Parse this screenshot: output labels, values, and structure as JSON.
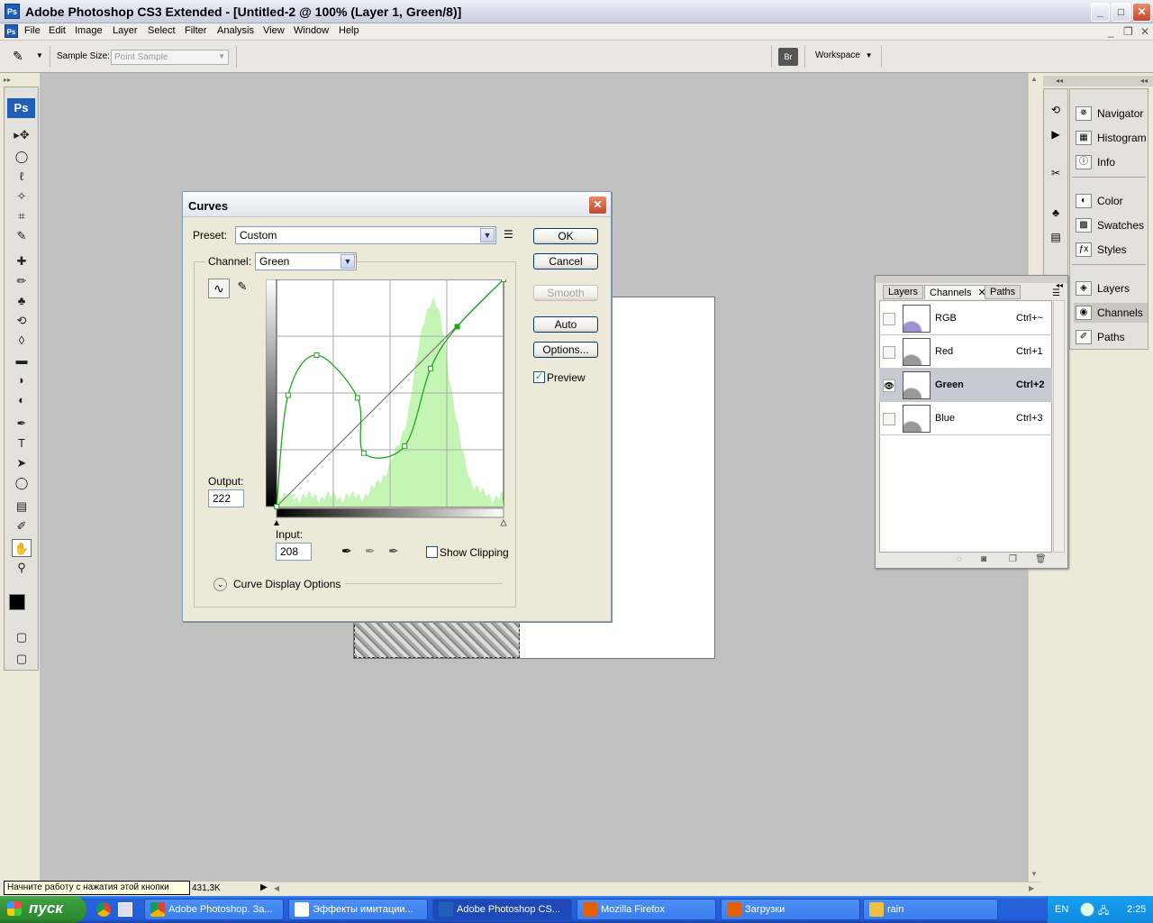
{
  "window": {
    "title": "Adobe Photoshop CS3 Extended - [Untitled-2 @ 100% (Layer 1, Green/8)]",
    "app_icon": "Ps",
    "minimize": "_",
    "maximize": "□",
    "close": "✕",
    "doc_minimize": "_",
    "doc_restore": "❐",
    "doc_close": "✕"
  },
  "menu": [
    "File",
    "Edit",
    "Image",
    "Layer",
    "Select",
    "Filter",
    "Analysis",
    "View",
    "Window",
    "Help"
  ],
  "options_bar": {
    "sample_size_label": "Sample Size:",
    "sample_size_value": "Point Sample",
    "workspace_label": "Workspace"
  },
  "toolbox": {
    "logo": "Ps",
    "tools": [
      "▸✥",
      "◯",
      "ℓ",
      "✧",
      "⌗",
      "✎",
      "✚",
      "✏",
      "♣",
      "⟲",
      "◊",
      "▬",
      "◗",
      "◐",
      "✒",
      "T",
      "➤",
      "◯",
      "▤",
      "✐",
      "✋",
      "⚲",
      "◧",
      "▢"
    ]
  },
  "curves": {
    "title": "Curves",
    "preset_label": "Preset:",
    "preset_value": "Custom",
    "channel_label": "Channel:",
    "channel_value": "Green",
    "output_label": "Output:",
    "output_value": "222",
    "input_label": "Input:",
    "input_value": "208",
    "show_clipping": "Show Clipping",
    "curve_display_options": "Curve Display Options",
    "ok": "OK",
    "cancel": "Cancel",
    "smooth": "Smooth",
    "auto": "Auto",
    "options": "Options...",
    "preview": "Preview",
    "preview_checked": "✓",
    "curve_points": [
      [
        0,
        0
      ],
      [
        13,
        125
      ],
      [
        45,
        170
      ],
      [
        91,
        122
      ],
      [
        98,
        60
      ],
      [
        144,
        68
      ],
      [
        173,
        155
      ],
      [
        203,
        202
      ],
      [
        255,
        255
      ]
    ]
  },
  "dock": {
    "groups": [
      [
        "Navigator",
        "Histogram",
        "Info"
      ],
      [
        "Color",
        "Swatches",
        "Styles"
      ],
      [
        "Layers",
        "Channels",
        "Paths"
      ]
    ]
  },
  "channels_panel": {
    "tabs": [
      "Layers",
      "Channels",
      "Paths"
    ],
    "rows": [
      {
        "name": "RGB",
        "shortcut": "Ctrl+~"
      },
      {
        "name": "Red",
        "shortcut": "Ctrl+1"
      },
      {
        "name": "Green",
        "shortcut": "Ctrl+2"
      },
      {
        "name": "Blue",
        "shortcut": "Ctrl+3"
      }
    ]
  },
  "status": {
    "doc_size": "431,3K",
    "tooltip": "Начните работу с нажатия этой кнопки"
  },
  "taskbar": {
    "start": "пуск",
    "tasks": [
      "Adobe Photoshop. За...",
      "Эффекты имитации...",
      "Adobe Photoshop CS...",
      "Mozilla Firefox",
      "Загрузки",
      "rain"
    ],
    "lang": "EN",
    "clock": "2:25"
  }
}
